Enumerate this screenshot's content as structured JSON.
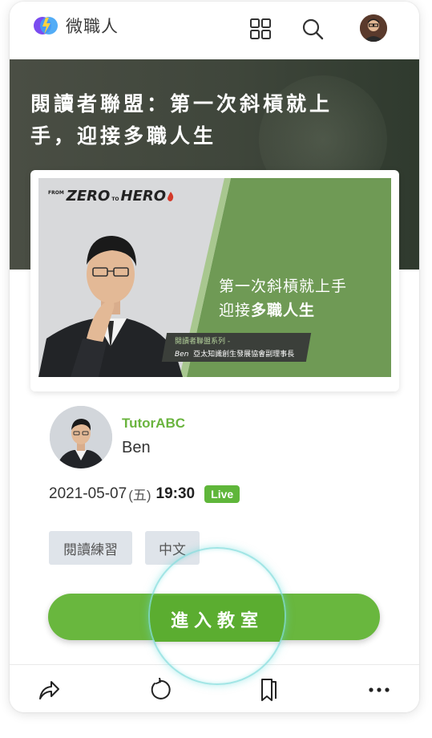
{
  "header": {
    "app_name": "微職人",
    "icons": [
      "logo-icon",
      "grid-icon",
      "search-icon",
      "avatar"
    ]
  },
  "hero": {
    "title_line1": "閱讀者聯盟：第一次斜槓就上",
    "title_line2": "手，迎接多職人生"
  },
  "banner": {
    "logo_small": "FROM",
    "logo_zero": "ZERO",
    "logo_to": "TO",
    "logo_hero": "HERO",
    "line1": "第一次斜槓就上手",
    "line2_prefix": "迎接",
    "line2_bold": "多職人生",
    "series": "閱讀者聯盟系列 -",
    "speaker_name": "Ben",
    "speaker_title": "亞太知識創生發展協會副理事長"
  },
  "instructor": {
    "org": "TutorABC",
    "name": "Ben"
  },
  "schedule": {
    "date": "2021-05-07",
    "weekday": "(五)",
    "time": "19:30",
    "badge": "Live"
  },
  "tags": [
    "閱讀練習",
    "中文"
  ],
  "cta": {
    "label": "進入教室"
  },
  "colors": {
    "accent": "#69b73e",
    "hero_bg": "#3f463b",
    "banner_green": "#6f9a55"
  },
  "bottom_bar": {
    "icons": [
      "share-icon",
      "refresh-icon",
      "bookmark-icon",
      "more-icon"
    ]
  }
}
